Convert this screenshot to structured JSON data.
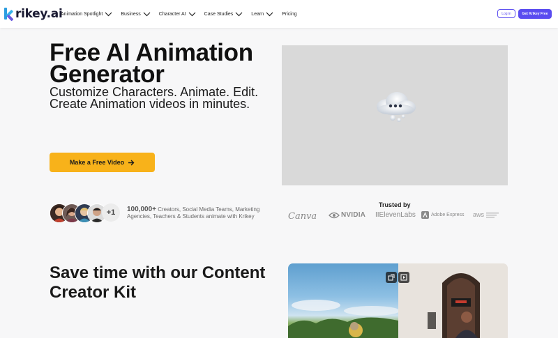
{
  "brand": {
    "logo_text": "rikey.ai",
    "logo_letter": "K"
  },
  "nav": {
    "items": [
      {
        "label": "Animation Spotlight",
        "has_dropdown": true
      },
      {
        "label": "Business",
        "has_dropdown": true
      },
      {
        "label": "Character AI",
        "has_dropdown": true
      },
      {
        "label": "Case Studies",
        "has_dropdown": true
      },
      {
        "label": "Learn",
        "has_dropdown": true
      },
      {
        "label": "Pricing",
        "has_dropdown": false
      }
    ],
    "login_label": "Log in",
    "get_label": "Get Krikey Free"
  },
  "hero": {
    "title": "Free AI Animation Generator",
    "subtitle": "Customize Characters. Animate. Edit. Create Animation videos in minutes.",
    "cta_label": "Make a Free Video"
  },
  "social_proof": {
    "plus_label": "+1",
    "count": "100,000+",
    "text": " Creators, Social Media Teams, Marketing Agencies, Teachers & Students animate with Krikey"
  },
  "trusted": {
    "heading": "Trusted by",
    "brands": [
      "Canva",
      "NVIDIA",
      "IIElevenLabs",
      "Adobe Express",
      "aws"
    ]
  },
  "section2": {
    "title": "Save time with our Content Creator Kit"
  },
  "colors": {
    "accent": "#5a4cf0",
    "cta": "#f8b21a",
    "logo_blue": "#2c9de0"
  }
}
